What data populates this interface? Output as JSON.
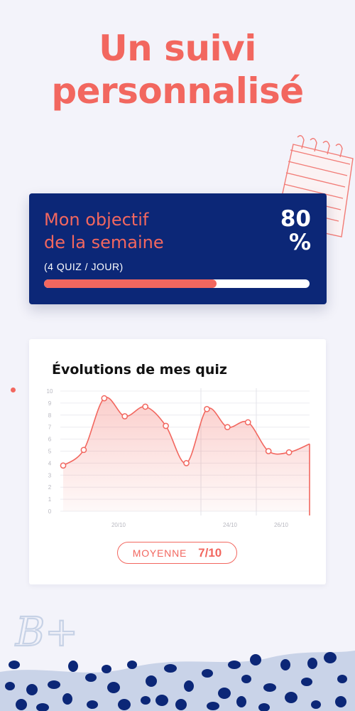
{
  "headline": {
    "line1": "Un suivi",
    "line2": "personnalisé"
  },
  "goal": {
    "title_line1": "Mon objectif",
    "title_line2": "de la semaine",
    "subtitle": "(4 QUIZ / JOUR)",
    "percent_value": "80",
    "percent_sign": "%",
    "progress_fraction": 0.65
  },
  "chart_card": {
    "title": "Évolutions de mes quiz",
    "average_label": "MOYENNE",
    "average_value": "7/10"
  },
  "decor": {
    "grade_text": "B+"
  },
  "colors": {
    "accent": "#f2675f",
    "navy": "#0c2777",
    "background": "#f3f3fa"
  },
  "chart_data": {
    "type": "area",
    "title": "Évolutions de mes quiz",
    "xlabel": "",
    "ylabel": "",
    "ylim": [
      0,
      10
    ],
    "yticks": [
      0,
      1,
      2,
      3,
      4,
      5,
      6,
      7,
      8,
      9,
      10
    ],
    "x_tick_labels": [
      "20/10",
      "24/10",
      "26/10"
    ],
    "series": [
      {
        "values": [
          3.8,
          5.1,
          9.4,
          7.9,
          8.7,
          7.1,
          4.0,
          8.5,
          7.0,
          7.4,
          5.0,
          4.9,
          5.6
        ]
      }
    ],
    "grid": true,
    "color": "#f2675f"
  }
}
